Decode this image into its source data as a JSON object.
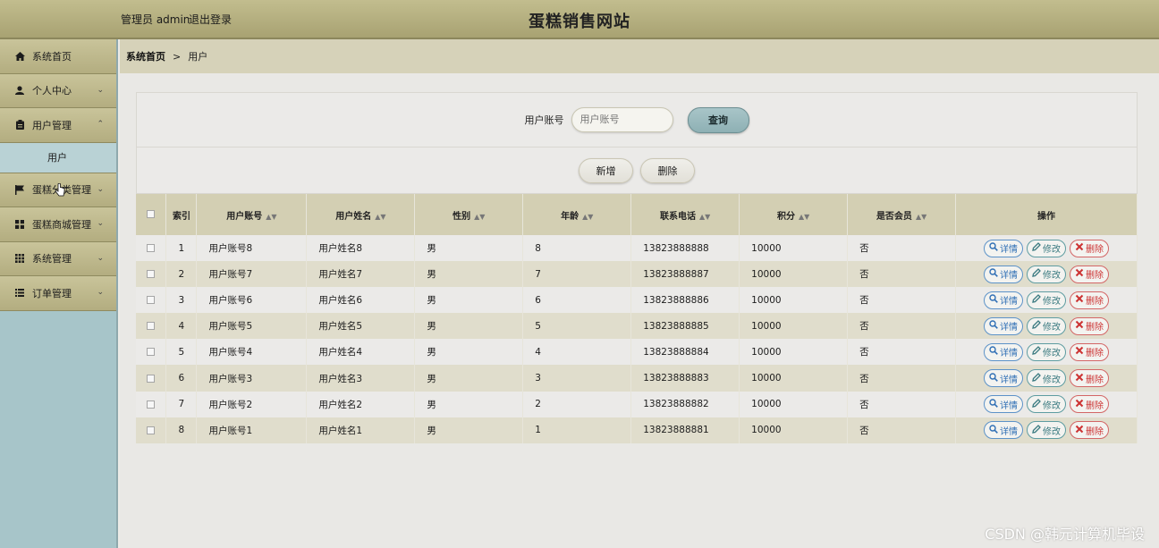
{
  "header": {
    "admin_text": "管理员 admin",
    "logout_label": "退出登录",
    "site_title": "蛋糕销售网站"
  },
  "sidebar": {
    "items": [
      {
        "label": "系统首页",
        "icon": "home-icon",
        "expandable": false
      },
      {
        "label": "个人中心",
        "icon": "person-icon",
        "expandable": true
      },
      {
        "label": "用户管理",
        "icon": "clipboard-icon",
        "expandable": true,
        "expanded": true,
        "sub": [
          "用户"
        ]
      },
      {
        "label": "蛋糕分类管理",
        "icon": "flag-icon",
        "expandable": true
      },
      {
        "label": "蛋糕商城管理",
        "icon": "grid-icon",
        "expandable": true
      },
      {
        "label": "系统管理",
        "icon": "apps-icon",
        "expandable": true
      },
      {
        "label": "订单管理",
        "icon": "list-icon",
        "expandable": true
      }
    ],
    "active_sub": "用户"
  },
  "breadcrumb": {
    "home": "系统首页",
    "separator": ">",
    "current": "用户"
  },
  "search": {
    "label": "用户账号",
    "placeholder": "用户账号",
    "query_label": "查询"
  },
  "actions": {
    "add_label": "新增",
    "delete_label": "删除"
  },
  "table": {
    "headers": [
      "索引",
      "用户账号",
      "用户姓名",
      "性别",
      "年龄",
      "联系电话",
      "积分",
      "是否会员",
      "操作"
    ],
    "rows": [
      {
        "index": "1",
        "account": "用户账号8",
        "name": "用户姓名8",
        "gender": "男",
        "age": "8",
        "phone": "13823888888",
        "points": "10000",
        "member": "否"
      },
      {
        "index": "2",
        "account": "用户账号7",
        "name": "用户姓名7",
        "gender": "男",
        "age": "7",
        "phone": "13823888887",
        "points": "10000",
        "member": "否"
      },
      {
        "index": "3",
        "account": "用户账号6",
        "name": "用户姓名6",
        "gender": "男",
        "age": "6",
        "phone": "13823888886",
        "points": "10000",
        "member": "否"
      },
      {
        "index": "4",
        "account": "用户账号5",
        "name": "用户姓名5",
        "gender": "男",
        "age": "5",
        "phone": "13823888885",
        "points": "10000",
        "member": "否"
      },
      {
        "index": "5",
        "account": "用户账号4",
        "name": "用户姓名4",
        "gender": "男",
        "age": "4",
        "phone": "13823888884",
        "points": "10000",
        "member": "否"
      },
      {
        "index": "6",
        "account": "用户账号3",
        "name": "用户姓名3",
        "gender": "男",
        "age": "3",
        "phone": "13823888883",
        "points": "10000",
        "member": "否"
      },
      {
        "index": "7",
        "account": "用户账号2",
        "name": "用户姓名2",
        "gender": "男",
        "age": "2",
        "phone": "13823888882",
        "points": "10000",
        "member": "否"
      },
      {
        "index": "8",
        "account": "用户账号1",
        "name": "用户姓名1",
        "gender": "男",
        "age": "1",
        "phone": "13823888881",
        "points": "10000",
        "member": "否"
      }
    ],
    "ops": {
      "detail": "详情",
      "edit": "修改",
      "delete": "删除"
    }
  },
  "watermark": "CSDN @韩元计算机毕设",
  "colors": {
    "header": "#b3ad80",
    "sidebar": "#a7c5c9",
    "table_header": "#d3cfb3",
    "detail": "#2f6fb5",
    "edit": "#3a7a80",
    "delete": "#cc3333"
  }
}
